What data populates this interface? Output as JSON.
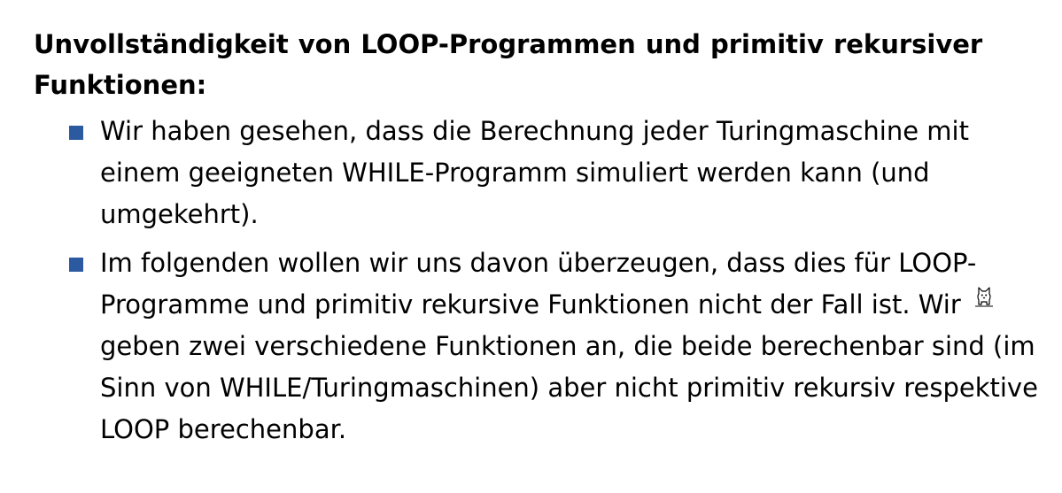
{
  "slide": {
    "heading": "Unvollständigkeit von LOOP-Programmen und primitiv rekursiver Funktionen:",
    "bullets": [
      {
        "text": "Wir haben gesehen, dass die Berechnung jeder Turingmaschine mit einem geeigneten WHILE-Programm simuliert werden kann (und umgekehrt)."
      },
      {
        "text": "Im folgenden wollen wir uns davon überzeugen, dass dies für LOOP-Programme und primitiv rekursive Funktionen nicht der Fall ist. Wir geben zwei verschiedene Funktionen an, die beide berechenbar sind (im Sinn von WHILE/Turingmaschinen) aber nicht primitiv rekursiv respektive LOOP berechenbar."
      }
    ],
    "bullet_color": "#2c5aa0"
  },
  "overlay": {
    "cursor_icon": "cat-cursor-icon"
  }
}
